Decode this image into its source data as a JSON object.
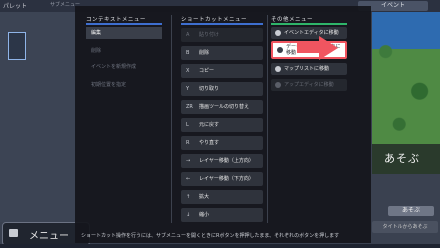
{
  "background": {
    "palette_tab": "パレット",
    "sub_tab": "サブメニュー",
    "event_tab": "イベント",
    "play_title": "あそぶ",
    "play_button": "あそぶ",
    "play_title_button": "タイトルからあそぶ",
    "menu_button": "メニュー"
  },
  "modal": {
    "context_menu": {
      "header": "コンテキストメニュー",
      "accent": "#3e6fd0",
      "items": [
        {
          "label": "編集",
          "active": true
        },
        {
          "label": "削除",
          "active": false
        },
        {
          "label": "イベントを新規作成",
          "active": false
        },
        {
          "label": "初期位置を指定",
          "active": false
        }
      ]
    },
    "shortcut_menu": {
      "header": "ショートカットメニュー",
      "accent": "#3e6fd0",
      "items": [
        {
          "key": "A",
          "label": "貼り付け",
          "enabled": false
        },
        {
          "key": "B",
          "label": "削除",
          "enabled": true
        },
        {
          "key": "X",
          "label": "コピー",
          "enabled": true
        },
        {
          "key": "Y",
          "label": "切り取り",
          "enabled": true
        },
        {
          "key": "ZR",
          "label": "描画ツールの切り替え",
          "enabled": true
        },
        {
          "key": "L",
          "label": "元に戻す",
          "enabled": true
        },
        {
          "key": "R",
          "label": "やり直す",
          "enabled": true
        },
        {
          "key": "→",
          "label": "レイヤー移動（上方向）",
          "enabled": true
        },
        {
          "key": "←",
          "label": "レイヤー移動（下方向）",
          "enabled": true
        },
        {
          "key": "↑",
          "label": "拡大",
          "enabled": true
        },
        {
          "key": "↓",
          "label": "縮小",
          "enabled": true
        }
      ]
    },
    "other_menu": {
      "header": "その他メニュー",
      "accent": "#2fb56a",
      "items": [
        {
          "label": "イベントエディタに移動",
          "state": "normal"
        },
        {
          "label": "データベースエディタに移動",
          "state": "highlight"
        },
        {
          "label": "マップリストに移動",
          "state": "normal"
        },
        {
          "label": "アップエディタに移動",
          "state": "disabled"
        }
      ]
    },
    "footer": "ショートカット操作を行うには、サブメニューを開くときにRボタンを押押したまま、それぞれのボタンを押します",
    "highlight_color": "#f05560"
  }
}
